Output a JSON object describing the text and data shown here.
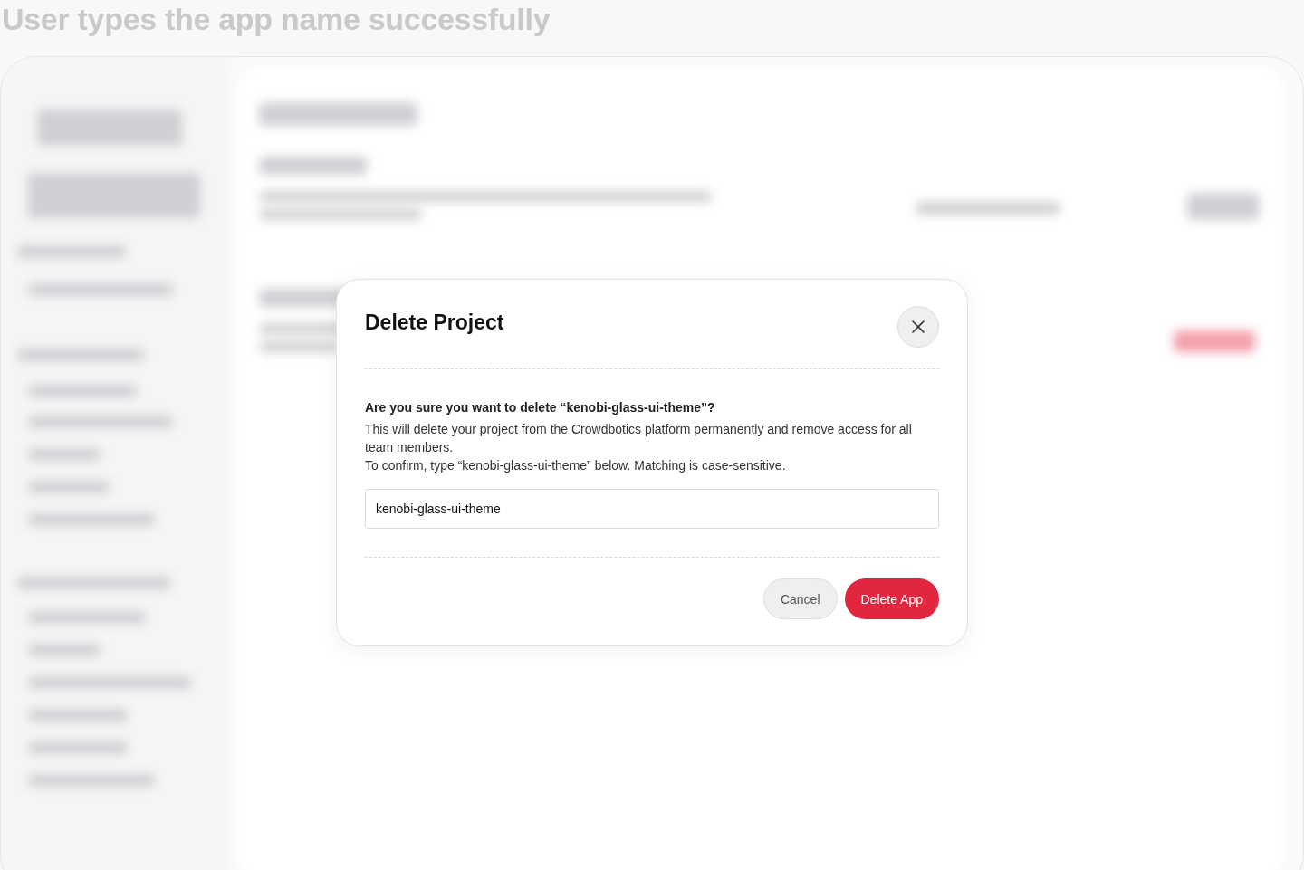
{
  "caption": "User types the app name successfully",
  "dialog": {
    "title": "Delete Project",
    "question": "Are you sure you want to delete “kenobi-glass-ui-theme”?",
    "description": "This will delete your project from the Crowdbotics platform permanently and remove access for all team members.",
    "instruction": "To confirm, type “kenobi-glass-ui-theme” below. Matching is case-sensitive.",
    "input": {
      "value": "kenobi-glass-ui-theme"
    },
    "buttons": [
      {
        "label": "Cancel",
        "kind": "secondary"
      },
      {
        "label": "Delete App",
        "kind": "danger"
      }
    ]
  }
}
